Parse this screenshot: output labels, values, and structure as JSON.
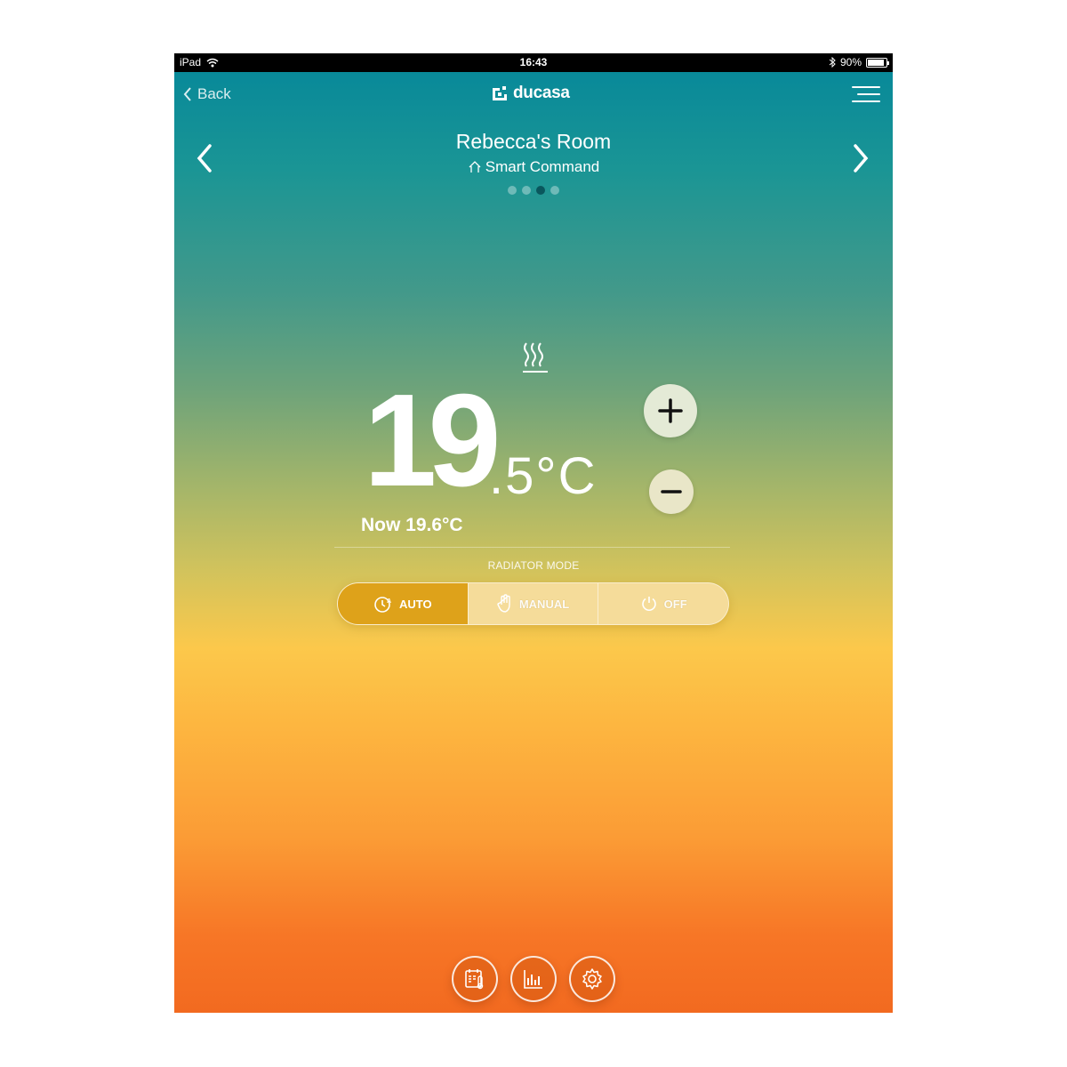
{
  "status_bar": {
    "device": "iPad",
    "time": "16:43",
    "battery": "90%",
    "battery_level": 0.9,
    "icons": [
      "wifi-icon",
      "bluetooth-icon",
      "battery-icon"
    ]
  },
  "header": {
    "back_label": "Back",
    "brand": "ducasa",
    "icons": [
      "chevron-left-icon",
      "ducasa-logo-icon",
      "menu-icon"
    ]
  },
  "room": {
    "title": "Rebecca's Room",
    "subtitle": "Smart Command",
    "page_count": 4,
    "active_page": 3
  },
  "thermostat": {
    "setpoint_int": "19",
    "setpoint_dec": ".5°C",
    "current": "Now 19.6°C",
    "setpoint_value": 19.5,
    "current_value": 19.6,
    "heating_icon": "heating-icon"
  },
  "mode": {
    "label": "RADIATOR MODE",
    "options": [
      {
        "label": "AUTO",
        "icon": "clock-auto-icon",
        "active": true
      },
      {
        "label": "MANUAL",
        "icon": "hand-icon",
        "active": false
      },
      {
        "label": "OFF",
        "icon": "power-icon",
        "active": false
      }
    ]
  },
  "bottom_nav": [
    "schedule-icon",
    "statistics-icon",
    "settings-icon"
  ],
  "colors": {
    "gradient_top": "#05879a",
    "gradient_mid": "#fcc84b",
    "gradient_bottom": "#f26a20",
    "mode_active": "#dea21a"
  }
}
